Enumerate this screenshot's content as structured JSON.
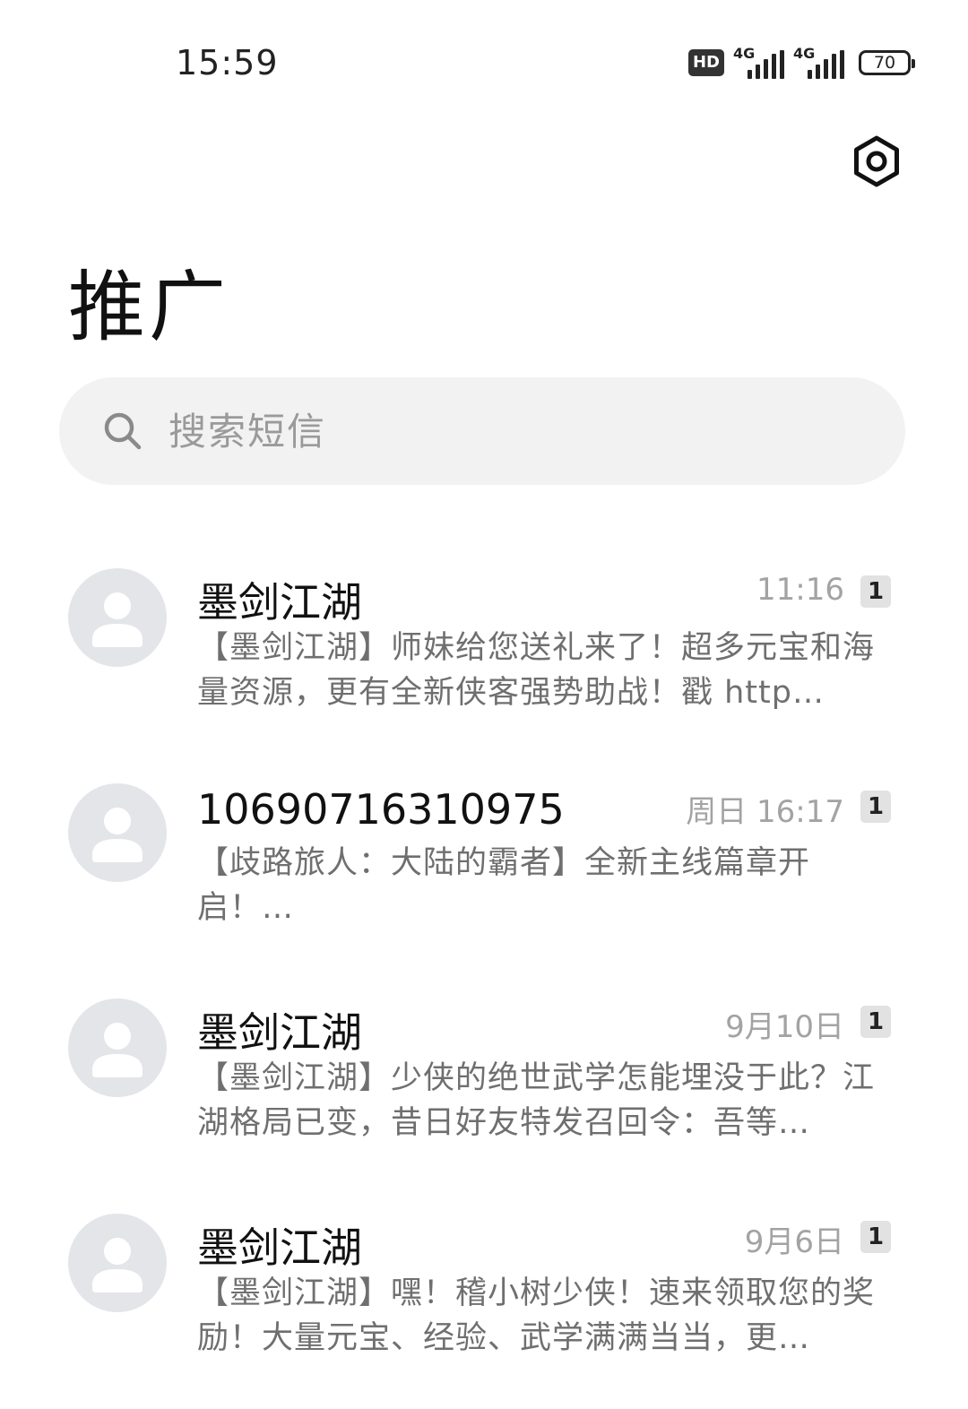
{
  "status_bar": {
    "time": "15:59",
    "hd_label": "HD",
    "network_1": "4G",
    "network_2": "4G",
    "battery": "70"
  },
  "header": {
    "title": "推广",
    "settings_icon": "hexagon-settings-icon"
  },
  "search": {
    "placeholder": "搜索短信",
    "icon": "search-icon"
  },
  "messages": [
    {
      "sender": "墨剑江湖",
      "time": "11:16",
      "badge": "1",
      "preview": "【墨剑江湖】师妹给您送礼来了！超多元宝和海量资源，更有全新侠客强势助战！戳 http…"
    },
    {
      "sender": "10690716310975",
      "time": "周日 16:17",
      "badge": "1",
      "preview": "【歧路旅人：大陆的霸者】全新主线篇章开启！…"
    },
    {
      "sender": "墨剑江湖",
      "time": "9月10日",
      "badge": "1",
      "preview": "【墨剑江湖】少侠的绝世武学怎能埋没于此？江湖格局已变，昔日好友特发召回令：吾等…"
    },
    {
      "sender": "墨剑江湖",
      "time": "9月6日",
      "badge": "1",
      "preview": "【墨剑江湖】嘿！稽小树少侠！速来领取您的奖励！大量元宝、经验、武学满满当当，更…"
    }
  ],
  "colors": {
    "background": "#ffffff",
    "search_bg": "#f2f2f2",
    "avatar_bg": "#e3e5e9",
    "secondary_text": "#a3a3a3",
    "preview_text": "#6f6f6f"
  }
}
